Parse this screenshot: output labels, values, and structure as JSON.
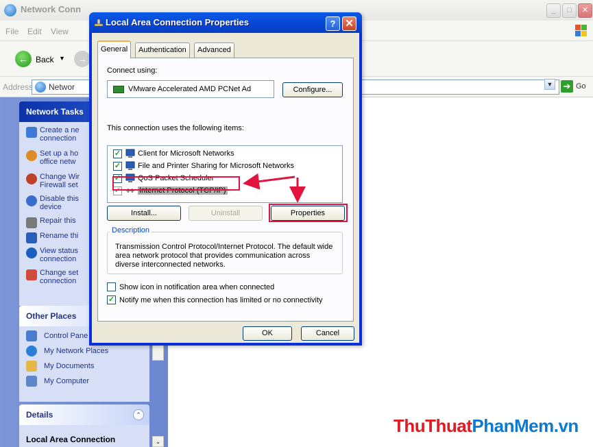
{
  "explorer": {
    "title": "Network Conn",
    "menu": [
      "File",
      "Edit",
      "View"
    ],
    "back_label": "Back",
    "address_label": "Address",
    "address_value": "Networ",
    "go_label": "Go",
    "network_tasks": {
      "header": "Network Tasks",
      "items": [
        {
          "label": "Create a ne\nconnection",
          "icon": "new-connection-icon"
        },
        {
          "label": "Set up a ho\noffice netw",
          "icon": "home-network-icon"
        },
        {
          "label": "Change Wir\nFirewall set",
          "icon": "firewall-icon"
        },
        {
          "label": "Disable this\ndevice",
          "icon": "disable-device-icon"
        },
        {
          "label": "Repair this",
          "icon": "repair-icon"
        },
        {
          "label": "Rename thi",
          "icon": "rename-icon"
        },
        {
          "label": "View status\nconnection",
          "icon": "status-icon"
        },
        {
          "label": "Change set\nconnection",
          "icon": "settings-icon"
        }
      ]
    },
    "other_places": {
      "header": "Other Places",
      "items": [
        {
          "label": "Control Pane",
          "icon": "control-panel-icon"
        },
        {
          "label": "My Network Places",
          "icon": "network-places-icon"
        },
        {
          "label": "My Documents",
          "icon": "documents-icon"
        },
        {
          "label": "My Computer",
          "icon": "computer-icon"
        }
      ]
    },
    "details": {
      "header": "Details",
      "title": "Local Area Connection"
    }
  },
  "dialog": {
    "title": "Local Area Connection Properties",
    "help": "?",
    "close": "✕",
    "tabs": [
      "General",
      "Authentication",
      "Advanced"
    ],
    "active_tab": "General",
    "connect_using_label": "Connect using:",
    "adapter_name": "VMware Accelerated AMD PCNet Ad",
    "configure_label": "Configure...",
    "items_label": "This connection uses the following items:",
    "items": [
      {
        "label": "Client for Microsoft Networks",
        "checked": true,
        "icon": "network-client-icon"
      },
      {
        "label": "File and Printer Sharing for Microsoft Networks",
        "checked": true,
        "icon": "file-printer-sharing-icon"
      },
      {
        "label": "QoS Packet Scheduler",
        "checked": true,
        "icon": "qos-scheduler-icon"
      },
      {
        "label": "Internet Protocol (TCP/IP)",
        "checked": true,
        "icon": "protocol-icon",
        "selected": true
      }
    ],
    "install_label": "Install...",
    "uninstall_label": "Uninstall",
    "properties_label": "Properties",
    "description_legend": "Description",
    "description_text": "Transmission Control Protocol/Internet Protocol. The default wide area network protocol that provides communication across diverse interconnected networks.",
    "show_icon_label": "Show icon in notification area when connected",
    "show_icon_checked": false,
    "notify_label": "Notify me when this connection has limited or no connectivity",
    "notify_checked": true,
    "ok_label": "OK",
    "cancel_label": "Cancel"
  },
  "watermark": {
    "part1": "ThuThuat",
    "part2": "PhanMem.vn"
  },
  "colors": {
    "highlight": "#e0143c",
    "accent": "#0745d3"
  }
}
